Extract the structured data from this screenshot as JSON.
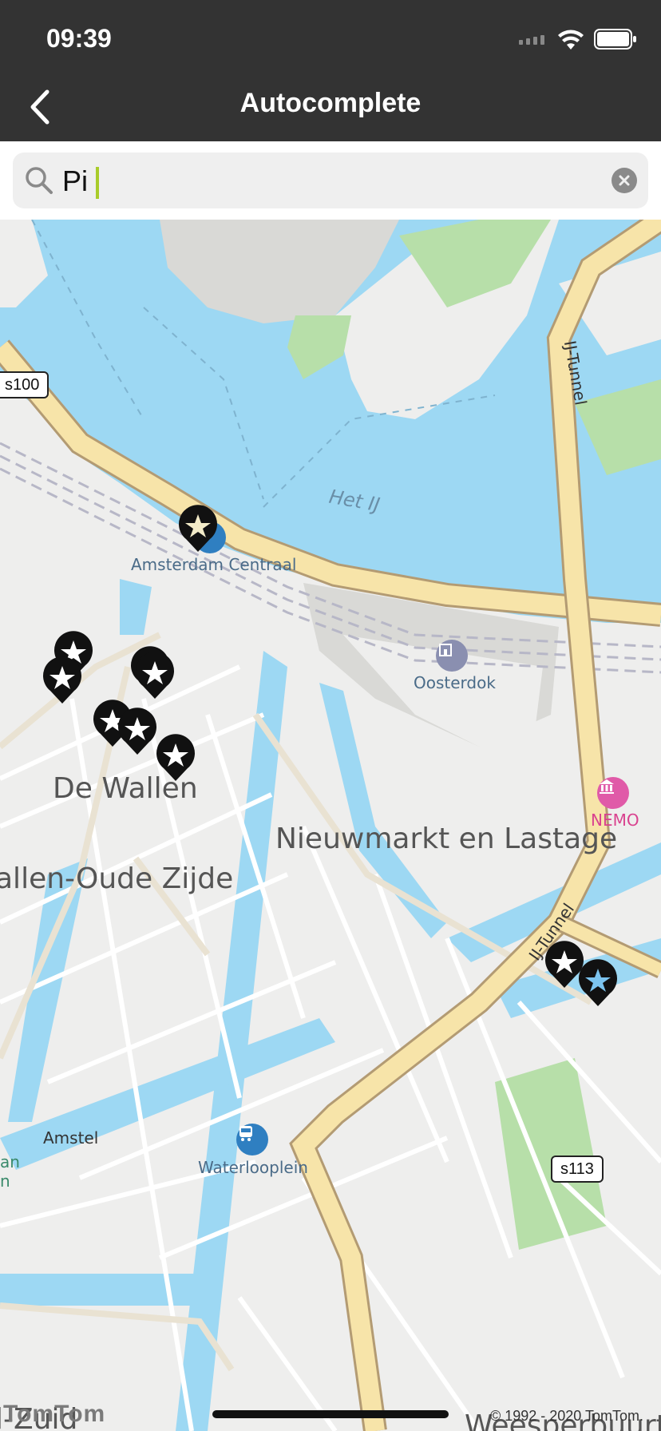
{
  "status_bar": {
    "time": "09:39"
  },
  "nav": {
    "title": "Autocomplete"
  },
  "search": {
    "value": "Pi",
    "placeholder": ""
  },
  "map": {
    "districts": [
      "De Wallen",
      "Nieuwmarkt en Lastage",
      "allen-Oude Zijde",
      "Weesperbuurt",
      "l-Zuid"
    ],
    "water_label": "Het IJ",
    "pois": [
      "Amsterdam Centraal",
      "Oosterdok",
      "NEMO",
      "Waterlooplein"
    ],
    "roads": [
      "IJ-Tunnel",
      "IJ-Tunnel",
      "Amstel"
    ],
    "shields": [
      "s100",
      "s113"
    ],
    "edge_labels": [
      "an",
      "n"
    ],
    "attribution": "© 1992 - 2020 TomTom.",
    "logo": "TomTom"
  },
  "colors": {
    "water": "#9dd8f3",
    "land": "#eeeeed",
    "park": "#b7dfa9",
    "highway": "#f7e4a9",
    "pin": "#111111",
    "accent": "#a9cc2a"
  }
}
